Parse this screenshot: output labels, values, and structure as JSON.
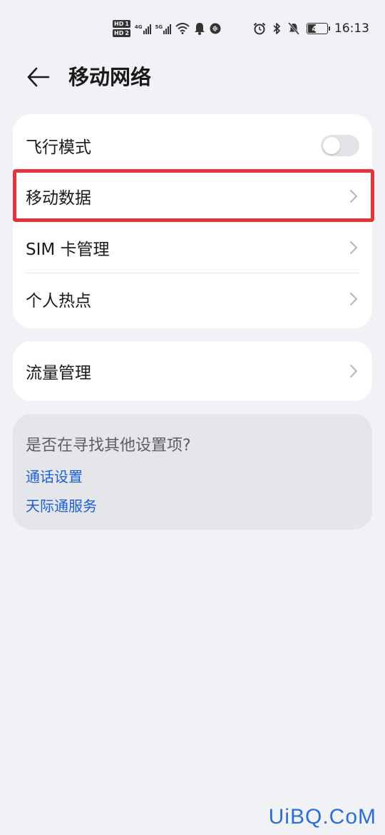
{
  "status_bar": {
    "hd1": "HD",
    "hd1_sim": "1",
    "hd2": "HD",
    "hd2_sim": "2",
    "net1": "4G",
    "net2": "5G",
    "battery": "47",
    "battery_level_pct": 47,
    "time": "16:13",
    "icons": [
      "signal-icon",
      "wifi-icon",
      "notification-bell-icon",
      "voice-assistant-icon",
      "alarm-icon",
      "bluetooth-icon",
      "mute-icon",
      "battery-icon"
    ]
  },
  "header": {
    "title": "移动网络"
  },
  "main_card": {
    "items": [
      {
        "label": "飞行模式",
        "control": "toggle",
        "enabled": false
      },
      {
        "label": "移动数据",
        "control": "chevron",
        "highlighted": true
      },
      {
        "label": "SIM 卡管理",
        "control": "chevron"
      },
      {
        "label": "个人热点",
        "control": "chevron"
      }
    ]
  },
  "traffic_card": {
    "label": "流量管理"
  },
  "suggestions": {
    "title": "是否在寻找其他设置项?",
    "links": [
      "通话设置",
      "天际通服务"
    ]
  },
  "colors": {
    "background": "#f1f2f5",
    "card": "#ffffff",
    "suggest_card": "#e4e6e9",
    "link": "#1c5ed6",
    "highlight": "#e8323c",
    "watermark": "#2c6fd1"
  },
  "watermark": "UiBQ.CoM"
}
